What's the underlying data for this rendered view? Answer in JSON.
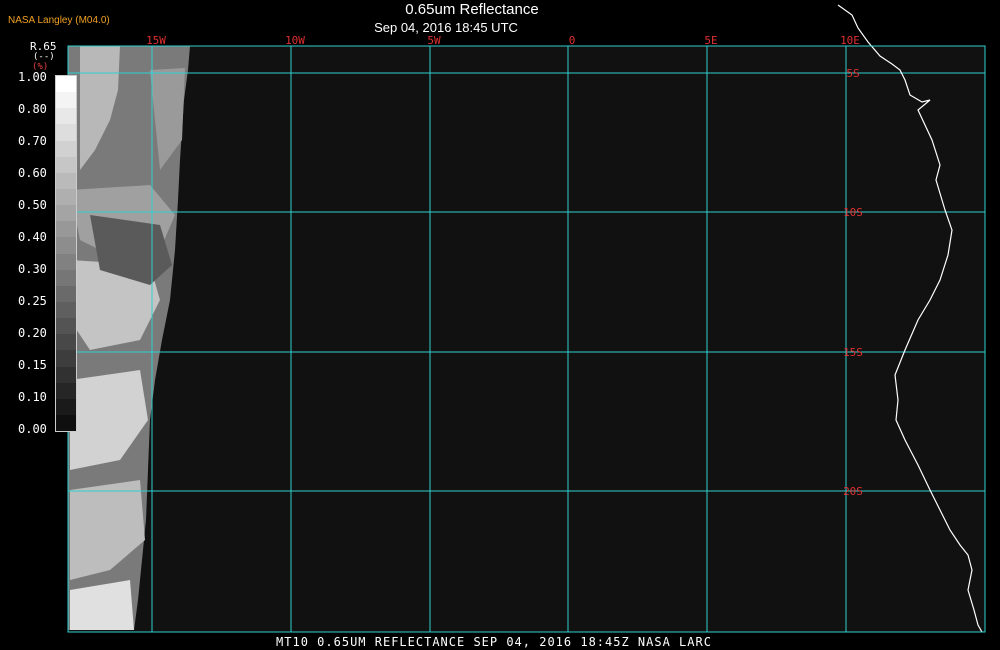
{
  "header": {
    "provider": "NASA Langley (M04.0)",
    "title": "0.65um Reflectance",
    "subtitle": "Sep 04, 2016 18:45 UTC"
  },
  "legend": {
    "title": "R.65",
    "unit": "(--)",
    "percent_tag": "(%)",
    "ticks": [
      "1.00",
      "0.80",
      "0.70",
      "0.60",
      "0.50",
      "0.40",
      "0.30",
      "0.25",
      "0.20",
      "0.15",
      "0.10",
      "0.00"
    ]
  },
  "map": {
    "longitude_labels": [
      "15W",
      "10W",
      "5W",
      "0",
      "5E",
      "10E"
    ],
    "latitude_labels": [
      "5S",
      "10S",
      "15S",
      "20S"
    ],
    "grid_color": "#2fd0d0",
    "label_color": "#e03030",
    "coastline_color": "#ffffff",
    "background_color": "#111111"
  },
  "footer": {
    "caption": "MT10  0.65UM REFLECTANCE   SEP 04, 2016 18:45Z   NASA LARC"
  }
}
